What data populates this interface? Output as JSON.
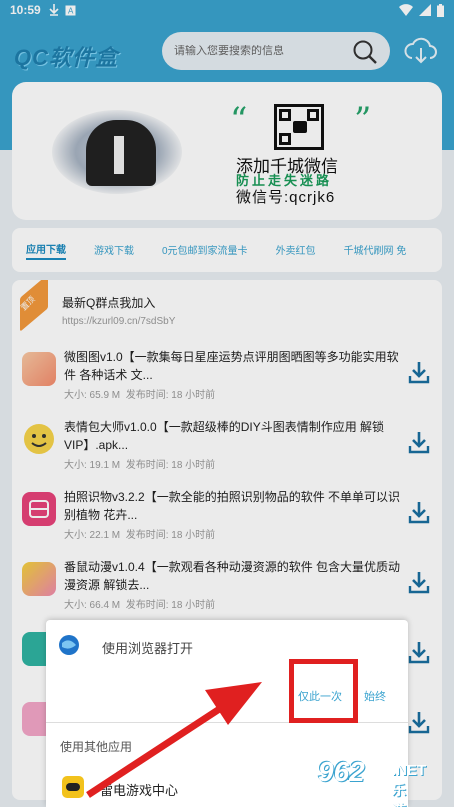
{
  "status_bar": {
    "time": "10:59"
  },
  "header": {
    "logo": "QC软件盒",
    "search_placeholder": "请输入您要搜索的信息"
  },
  "banner": {
    "wechat_title": "添加千城微信",
    "wechat_sub": "防止走失迷路",
    "wechat_id": "微信号:qcrjk6"
  },
  "tabs": [
    {
      "label": "应用下载"
    },
    {
      "label": "游戏下载"
    },
    {
      "label": "0元包邮到家流量卡"
    },
    {
      "label": "外卖红包"
    },
    {
      "label": "千城代刷网 免"
    }
  ],
  "notice": {
    "badge": "置顶",
    "title": "最新Q群点我加入",
    "url": "https://kzurl09.cn/7sdSbY"
  },
  "apps": [
    {
      "title": "微图图v1.0【一款集每日星座运势点评朋图晒图等多功能实用软件 各种话术 文...",
      "size": "大小: 65.9 M",
      "time": "发布时间: 18 小时前"
    },
    {
      "title": "表情包大师v1.0.0【一款超级棒的DIY斗图表情制作应用 解锁VIP】.apk...",
      "size": "大小: 19.1 M",
      "time": "发布时间: 18 小时前"
    },
    {
      "title": "拍照识物v3.2.2【一款全能的拍照识别物品的软件 不单单可以识别植物 花卉...",
      "size": "大小: 22.1 M",
      "time": "发布时间: 18 小时前"
    },
    {
      "title": "番鼠动漫v1.0.4【一款观看各种动漫资源的软件 包含大量优质动漫资源 解锁去...",
      "size": "大小: 66.4 M",
      "time": "发布时间: 18 小时前"
    }
  ],
  "sheet": {
    "title": "使用浏览器打开",
    "once": "仅此一次",
    "always": "始终",
    "other_label": "使用其他应用",
    "game_app": "雷电游戏中心"
  },
  "watermark": {
    "num": "962",
    "net": ".NET",
    "cn": "乐游网"
  },
  "colors": {
    "primary": "#3aa3cf",
    "highlight": "#e02020",
    "green": "#27a36b"
  }
}
